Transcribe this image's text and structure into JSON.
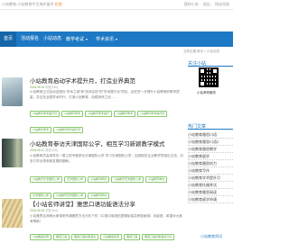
{
  "topbar": {
    "left_text": "小站教育-小站教育专注海外留学",
    "highlight": "在线",
    "right_items": [
      "我的小站",
      "退出",
      "网站导航"
    ]
  },
  "nav": {
    "items": [
      {
        "label": "首页",
        "active": true
      },
      {
        "label": "活动报名",
        "active": false
      },
      {
        "label": "小站动态",
        "active": false
      },
      {
        "label": "教学考试",
        "active": false,
        "dropdown": true
      },
      {
        "label": "学术资讯",
        "active": false,
        "dropdown": true
      }
    ]
  },
  "breadcrumb": "当前位置:首页 > 小站动态",
  "articles": [
    {
      "title": "小站教育启动学术提升月，打造业界典范",
      "meta": "2016-08-16",
      "meta_views": "浏览(236)",
      "summary": "小站教育正式启动全国为\"学术之城\"和\"西鸿名校\"的\"学术提升月\"项目，旨在进一步提升小站教育的教学质量，并且在全国学术时代，打造小站教育，站稳师资之优……",
      "tags": [
        "小站教育学术提升月",
        "小站教育学术",
        "小站教育学术提升",
        "小站教育学术",
        "小站教育学术提升月",
        "小站教育学术",
        "小站教育学术提升月"
      ]
    },
    {
      "title": "小站教育参访天津国际公学，相互学习新颖教学模式",
      "meta": "2016-08-11",
      "meta_views": "浏览(198)",
      "summary": "小站教育员会领导在一周之前专程参访天津国际公学 学习天津国际公学，加强相关企业教学的相互交流，对多方学业带来新发展的期盼。",
      "tags": [
        "小站教育天津国际公学",
        "天津国际公学",
        "小站教育参访",
        "小站教育天津国际公学",
        "小站教育参访",
        "天津国际公学",
        "小站教育天津国际公学",
        "小站教育参访"
      ]
    },
    {
      "title": "【小站名师讲堂】雅思口语功能语法分享",
      "meta": "2016-08-09",
      "meta_views": "浏览(164)",
      "summary": "小站雅思名师杨大家带来所谓雅思方法分析下的（口语中常用的逻辑衔接并积极使用）功能语，希望对大家有帮助！",
      "tags": [
        "小站雅思名师",
        "雅思口语",
        "雅思口语功能语法",
        "小站雅思名师",
        "雅思口语",
        "雅思口语功能语法分享"
      ]
    }
  ],
  "sidebar": {
    "follow_title": "关注小站",
    "qr_caption": "小站考研服务",
    "hot_title": "热门文章",
    "hot_items": [
      "小站教育雅思口语",
      "小站教育雅思口语2",
      "小站教育雅思教学",
      "小站教育留学",
      "小站教育雅思听力",
      "小站教育写作",
      "小站教育学术提升月",
      "小站教育托福考试",
      "小站教育雅思阅读",
      "小站教育留学申请"
    ]
  },
  "footer_link": "小站教育资讯"
}
